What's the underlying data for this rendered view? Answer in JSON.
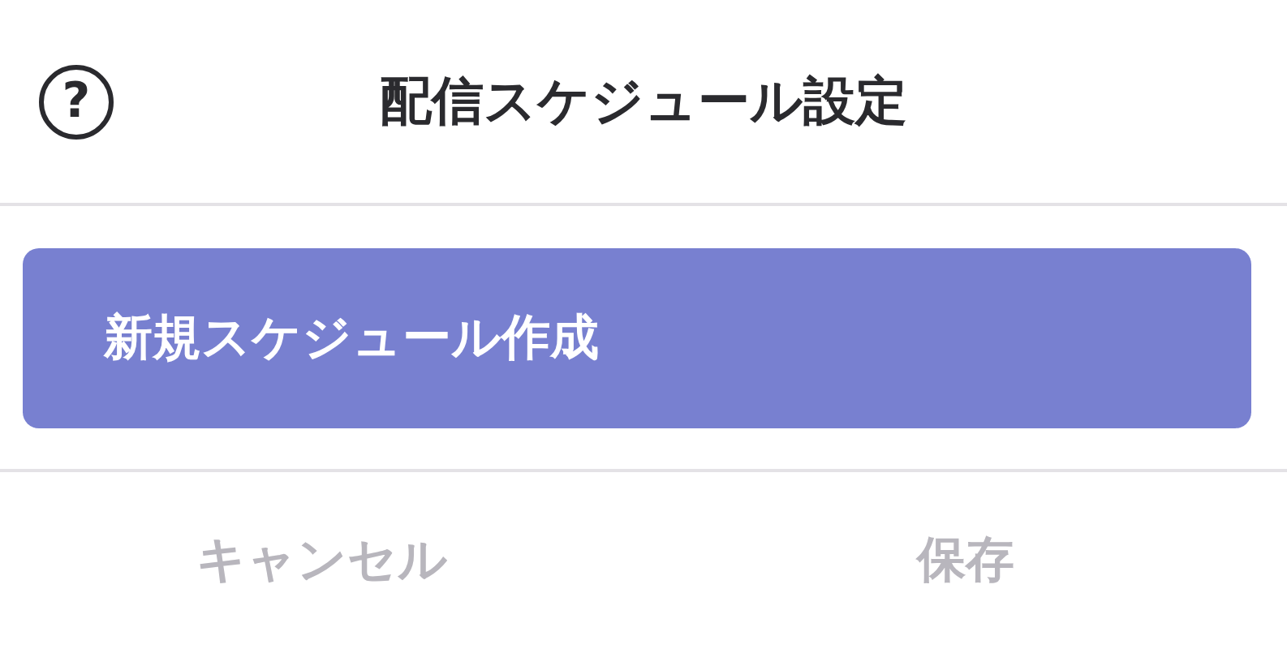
{
  "header": {
    "help_icon": "?",
    "title": "配信スケジュール設定"
  },
  "create_button": {
    "label": "新規スケジュール作成"
  },
  "footer_buttons": [
    {
      "label": "キャンセル",
      "disabled": true
    },
    {
      "label": "保存",
      "disabled": true
    }
  ]
}
